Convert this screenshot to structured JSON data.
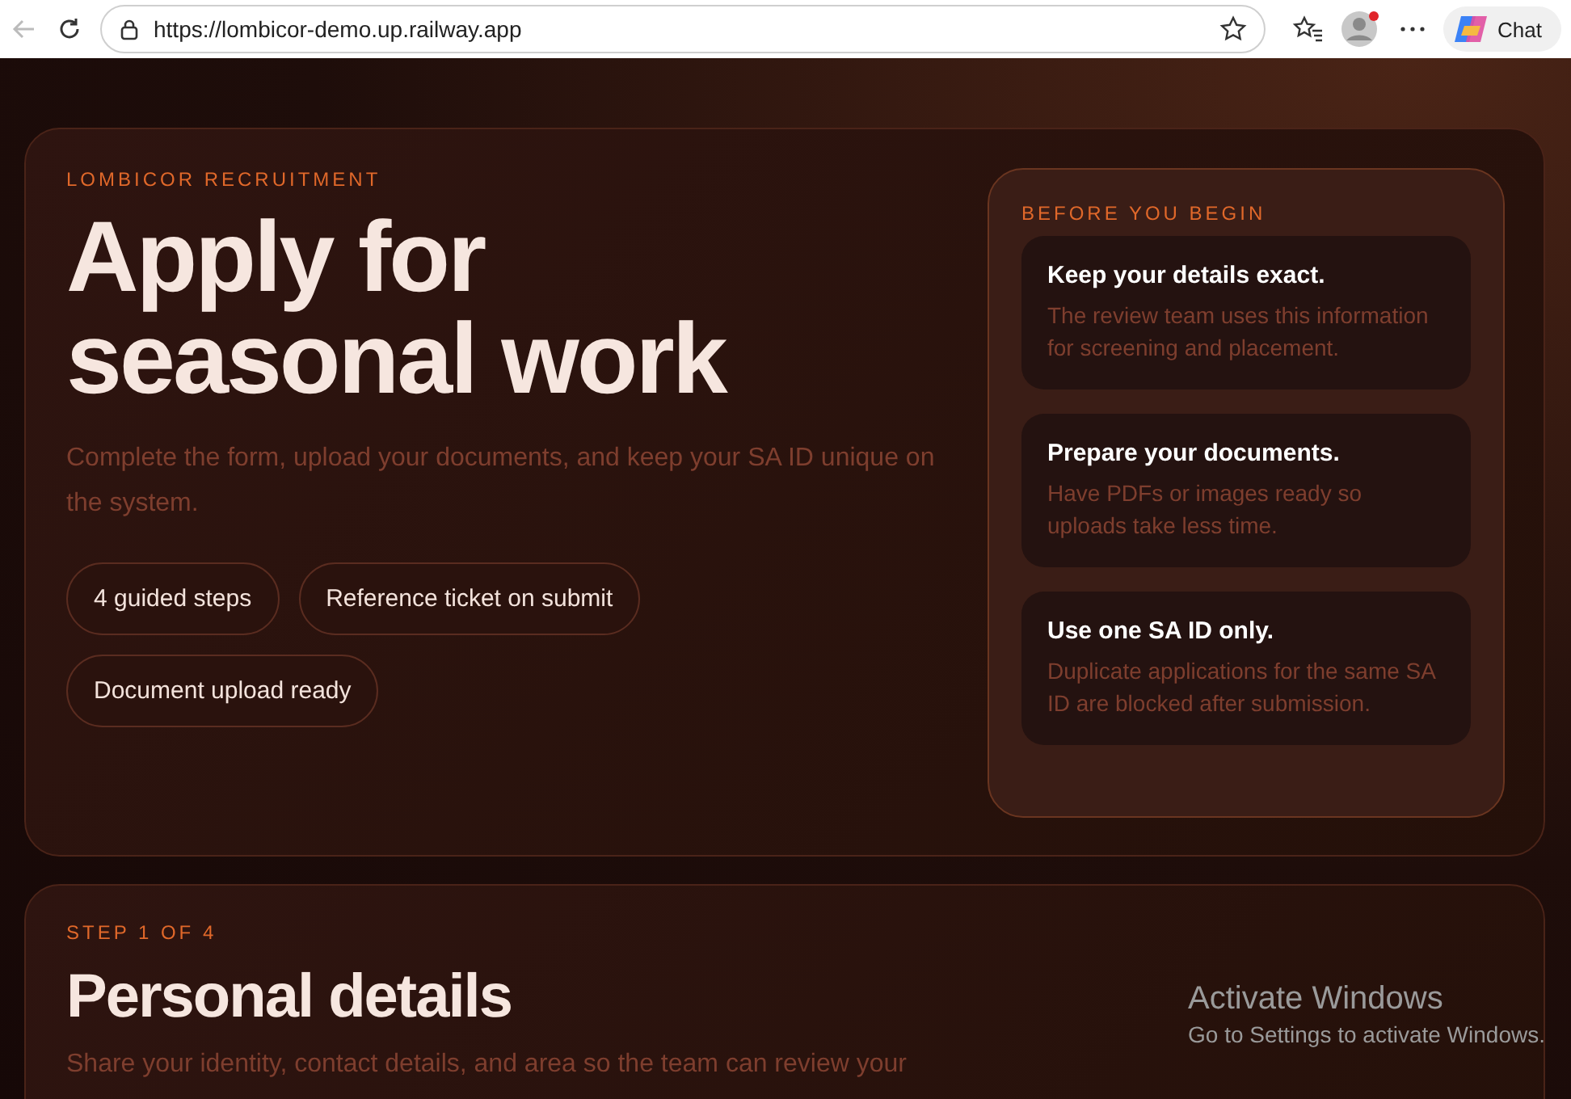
{
  "browser": {
    "url": "https://lombicor-demo.up.railway.app",
    "chat_label": "Chat"
  },
  "hero": {
    "eyebrow": "LOMBICOR RECRUITMENT",
    "title_lines": [
      "Apply for",
      "seasonal work"
    ],
    "subtitle": "Complete the form, upload your documents, and keep your SA ID unique on the system.",
    "chips": [
      "4 guided steps",
      "Reference ticket on submit",
      "Document upload ready"
    ]
  },
  "tips": {
    "heading": "BEFORE YOU BEGIN",
    "items": [
      {
        "title": "Keep your details exact.",
        "body": "The review team uses this information for screening and placement."
      },
      {
        "title": "Prepare your documents.",
        "body": "Have PDFs or images ready so uploads take less time."
      },
      {
        "title": "Use one SA ID only.",
        "body": "Duplicate applications for the same SA ID are blocked after submission."
      }
    ]
  },
  "step": {
    "eyebrow": "STEP 1 OF 4",
    "title": "Personal details",
    "subtitle": "Share your identity, contact details, and area so the team can review your"
  },
  "os_notice": {
    "title": "Activate Windows",
    "body": "Go to Settings to activate Windows."
  }
}
